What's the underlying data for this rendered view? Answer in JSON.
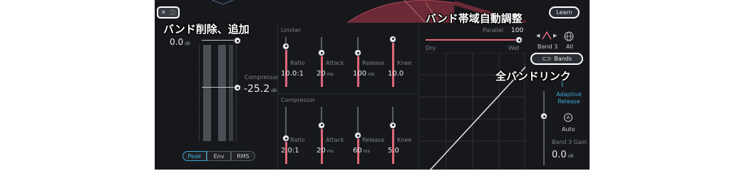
{
  "annotations": {
    "band_delete_add": "バンド削除、追加",
    "band_auto_adjust": "バンド帯域自動調整",
    "link_all_bands": "全バンドリンク"
  },
  "header": {
    "close_icon": "✕",
    "learn_label": "Learn"
  },
  "meter": {
    "top_value": "0.0",
    "top_unit": "dB",
    "modes": [
      "Peak",
      "Env",
      "RMS"
    ],
    "active_mode": "Peak",
    "compressor_label": "Compressor",
    "compressor_value": "-25.2",
    "compressor_unit": "dB"
  },
  "limiter": {
    "section_label": "Limiter",
    "controls": [
      {
        "label": "Ratio",
        "value": "10.0:1",
        "unit": "",
        "level": 0.82
      },
      {
        "label": "Attack",
        "value": "20",
        "unit": "ms",
        "level": 0.68
      },
      {
        "label": "Release",
        "value": "100",
        "unit": "ms",
        "level": 0.68
      },
      {
        "label": "Knee",
        "value": "10.0",
        "unit": "",
        "level": 0.96
      }
    ]
  },
  "compressor": {
    "section_label": "Compressor",
    "controls": [
      {
        "label": "Ratio",
        "value": "2.0:1",
        "unit": "",
        "level": 0.45
      },
      {
        "label": "Attack",
        "value": "20",
        "unit": "ms",
        "level": 0.68
      },
      {
        "label": "Release",
        "value": "60",
        "unit": "ms",
        "level": 0.5
      },
      {
        "label": "Knee",
        "value": "5.0",
        "unit": "",
        "level": 0.68
      }
    ]
  },
  "parallel": {
    "label": "Parallel",
    "value": "100",
    "dry_label": "Dry",
    "wet_label": "Wet",
    "level": 1.0
  },
  "band": {
    "current_label": "Band 3",
    "all_label": "All",
    "bands_button_label": "Bands",
    "adaptive_release_label": "Adaptive Release",
    "auto_label": "Auto",
    "gain_label": "Band 3 Gain",
    "gain_value": "0.0",
    "gain_unit": "dB"
  },
  "colors": {
    "accent": "#e0677a",
    "panel_bg": "#17181c",
    "highlight_blue": "#3fa7d6"
  }
}
